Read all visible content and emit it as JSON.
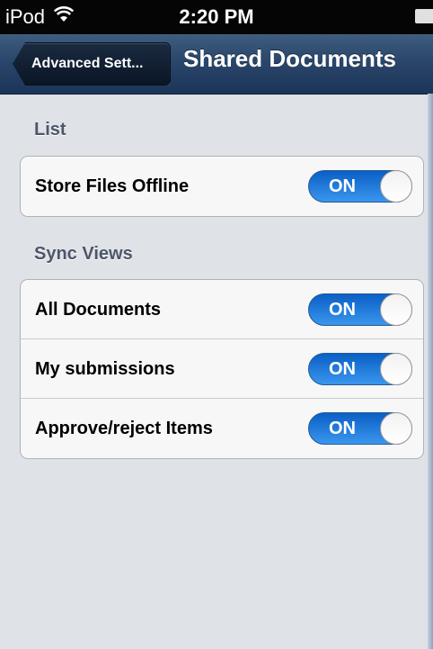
{
  "status_bar": {
    "carrier": "iPod",
    "wifi_icon": "wifi-icon",
    "time": "2:20 PM",
    "battery_icon": "battery-icon"
  },
  "nav": {
    "back_label": "Advanced Sett...",
    "title": "Shared Documents"
  },
  "sections": {
    "list": {
      "header": "List",
      "rows": [
        {
          "label": "Store Files Offline",
          "state": "ON"
        }
      ]
    },
    "sync_views": {
      "header": "Sync Views",
      "rows": [
        {
          "label": "All Documents",
          "state": "ON"
        },
        {
          "label": "My submissions",
          "state": "ON"
        },
        {
          "label": "Approve/reject Items",
          "state": "ON"
        }
      ]
    }
  },
  "colors": {
    "toggle_on": "#1a74dc",
    "nav_bar": "#2a466a",
    "background": "#dfe2e7"
  }
}
